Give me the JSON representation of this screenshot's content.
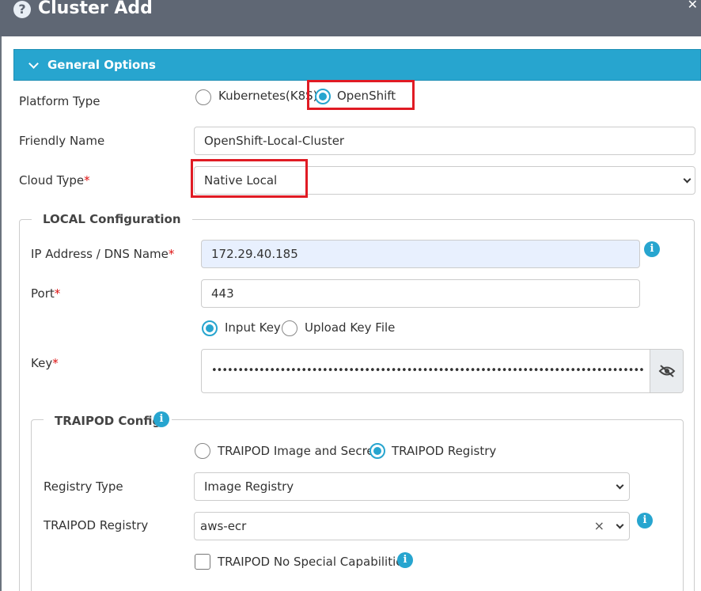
{
  "dialog": {
    "title": "Cluster Add",
    "help_glyph": "?",
    "close_glyph": "✕"
  },
  "section": {
    "title": "General Options"
  },
  "platform": {
    "label": "Platform Type",
    "options": [
      "Kubernetes(K8S)",
      "OpenShift"
    ],
    "selected": "OpenShift"
  },
  "friendly_name": {
    "label": "Friendly Name",
    "value": "OpenShift-Local-Cluster"
  },
  "cloud_type": {
    "label": "Cloud Type",
    "required": "*",
    "value": "Native Local"
  },
  "local_config": {
    "legend": "LOCAL Configuration",
    "ip": {
      "label": "IP Address / DNS Name",
      "required": "*",
      "value": "172.29.40.185"
    },
    "port": {
      "label": "Port",
      "required": "*",
      "value": "443"
    },
    "key_mode": {
      "options": [
        "Input Key",
        "Upload Key File"
      ],
      "selected": "Input Key"
    },
    "key": {
      "label": "Key",
      "required": "*",
      "value": "••••••••••••••••••••••••••••••••••••••••••••••••••••••••••••••••••••••••••••••••••"
    }
  },
  "traipod": {
    "legend": "TRAIPOD Config",
    "mode": {
      "options": [
        "TRAIPOD Image and Secret",
        "TRAIPOD Registry"
      ],
      "selected": "TRAIPOD Registry"
    },
    "registry_type": {
      "label": "Registry Type",
      "value": "Image Registry"
    },
    "registry": {
      "label": "TRAIPOD Registry",
      "value": "aws-ecr",
      "clear_glyph": "×"
    },
    "no_special_caps": {
      "label": "TRAIPOD No Special Capabilities",
      "checked": false
    }
  },
  "info_glyph": "i",
  "colors": {
    "accent": "#27a5cf",
    "titlebar": "#5f6774",
    "highlight": "#e01b24",
    "required": "#dd1111"
  }
}
